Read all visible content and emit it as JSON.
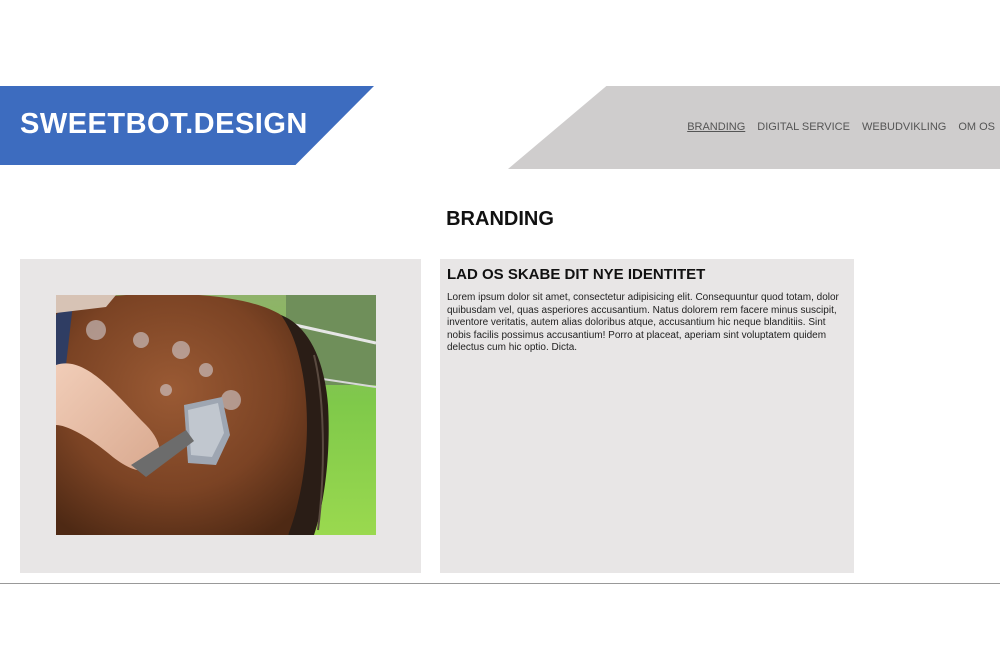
{
  "logo": {
    "text": "SWEETBOT.DESIGN"
  },
  "nav": {
    "items": [
      {
        "label": "BRANDING",
        "active": true
      },
      {
        "label": "DIGITAL SERVICE",
        "active": false
      },
      {
        "label": "WEBUDVIKLING",
        "active": false
      },
      {
        "label": "OM OS",
        "active": false
      }
    ]
  },
  "page": {
    "title": "BRANDING"
  },
  "section": {
    "heading": "LAD OS SKABE DIT NYE IDENTITET",
    "body": "Lorem ipsum dolor sit amet, consectetur adipisicing elit. Consequuntur quod totam, dolor quibusdam vel, quas asperiores accusantium. Natus dolorem rem facere minus suscipit, inventore veritatis, autem alias doloribus atque, accusantium hic neque blanditiis. Sint nobis facilis possimus accusantium! Porro at placeat, aperiam sint voluptatem quidem delectus cum hic optio. Dicta."
  },
  "colors": {
    "brand_blue": "#3d6cbf",
    "nav_gray": "#cfcdcd",
    "card_bg": "#e8e6e6"
  }
}
